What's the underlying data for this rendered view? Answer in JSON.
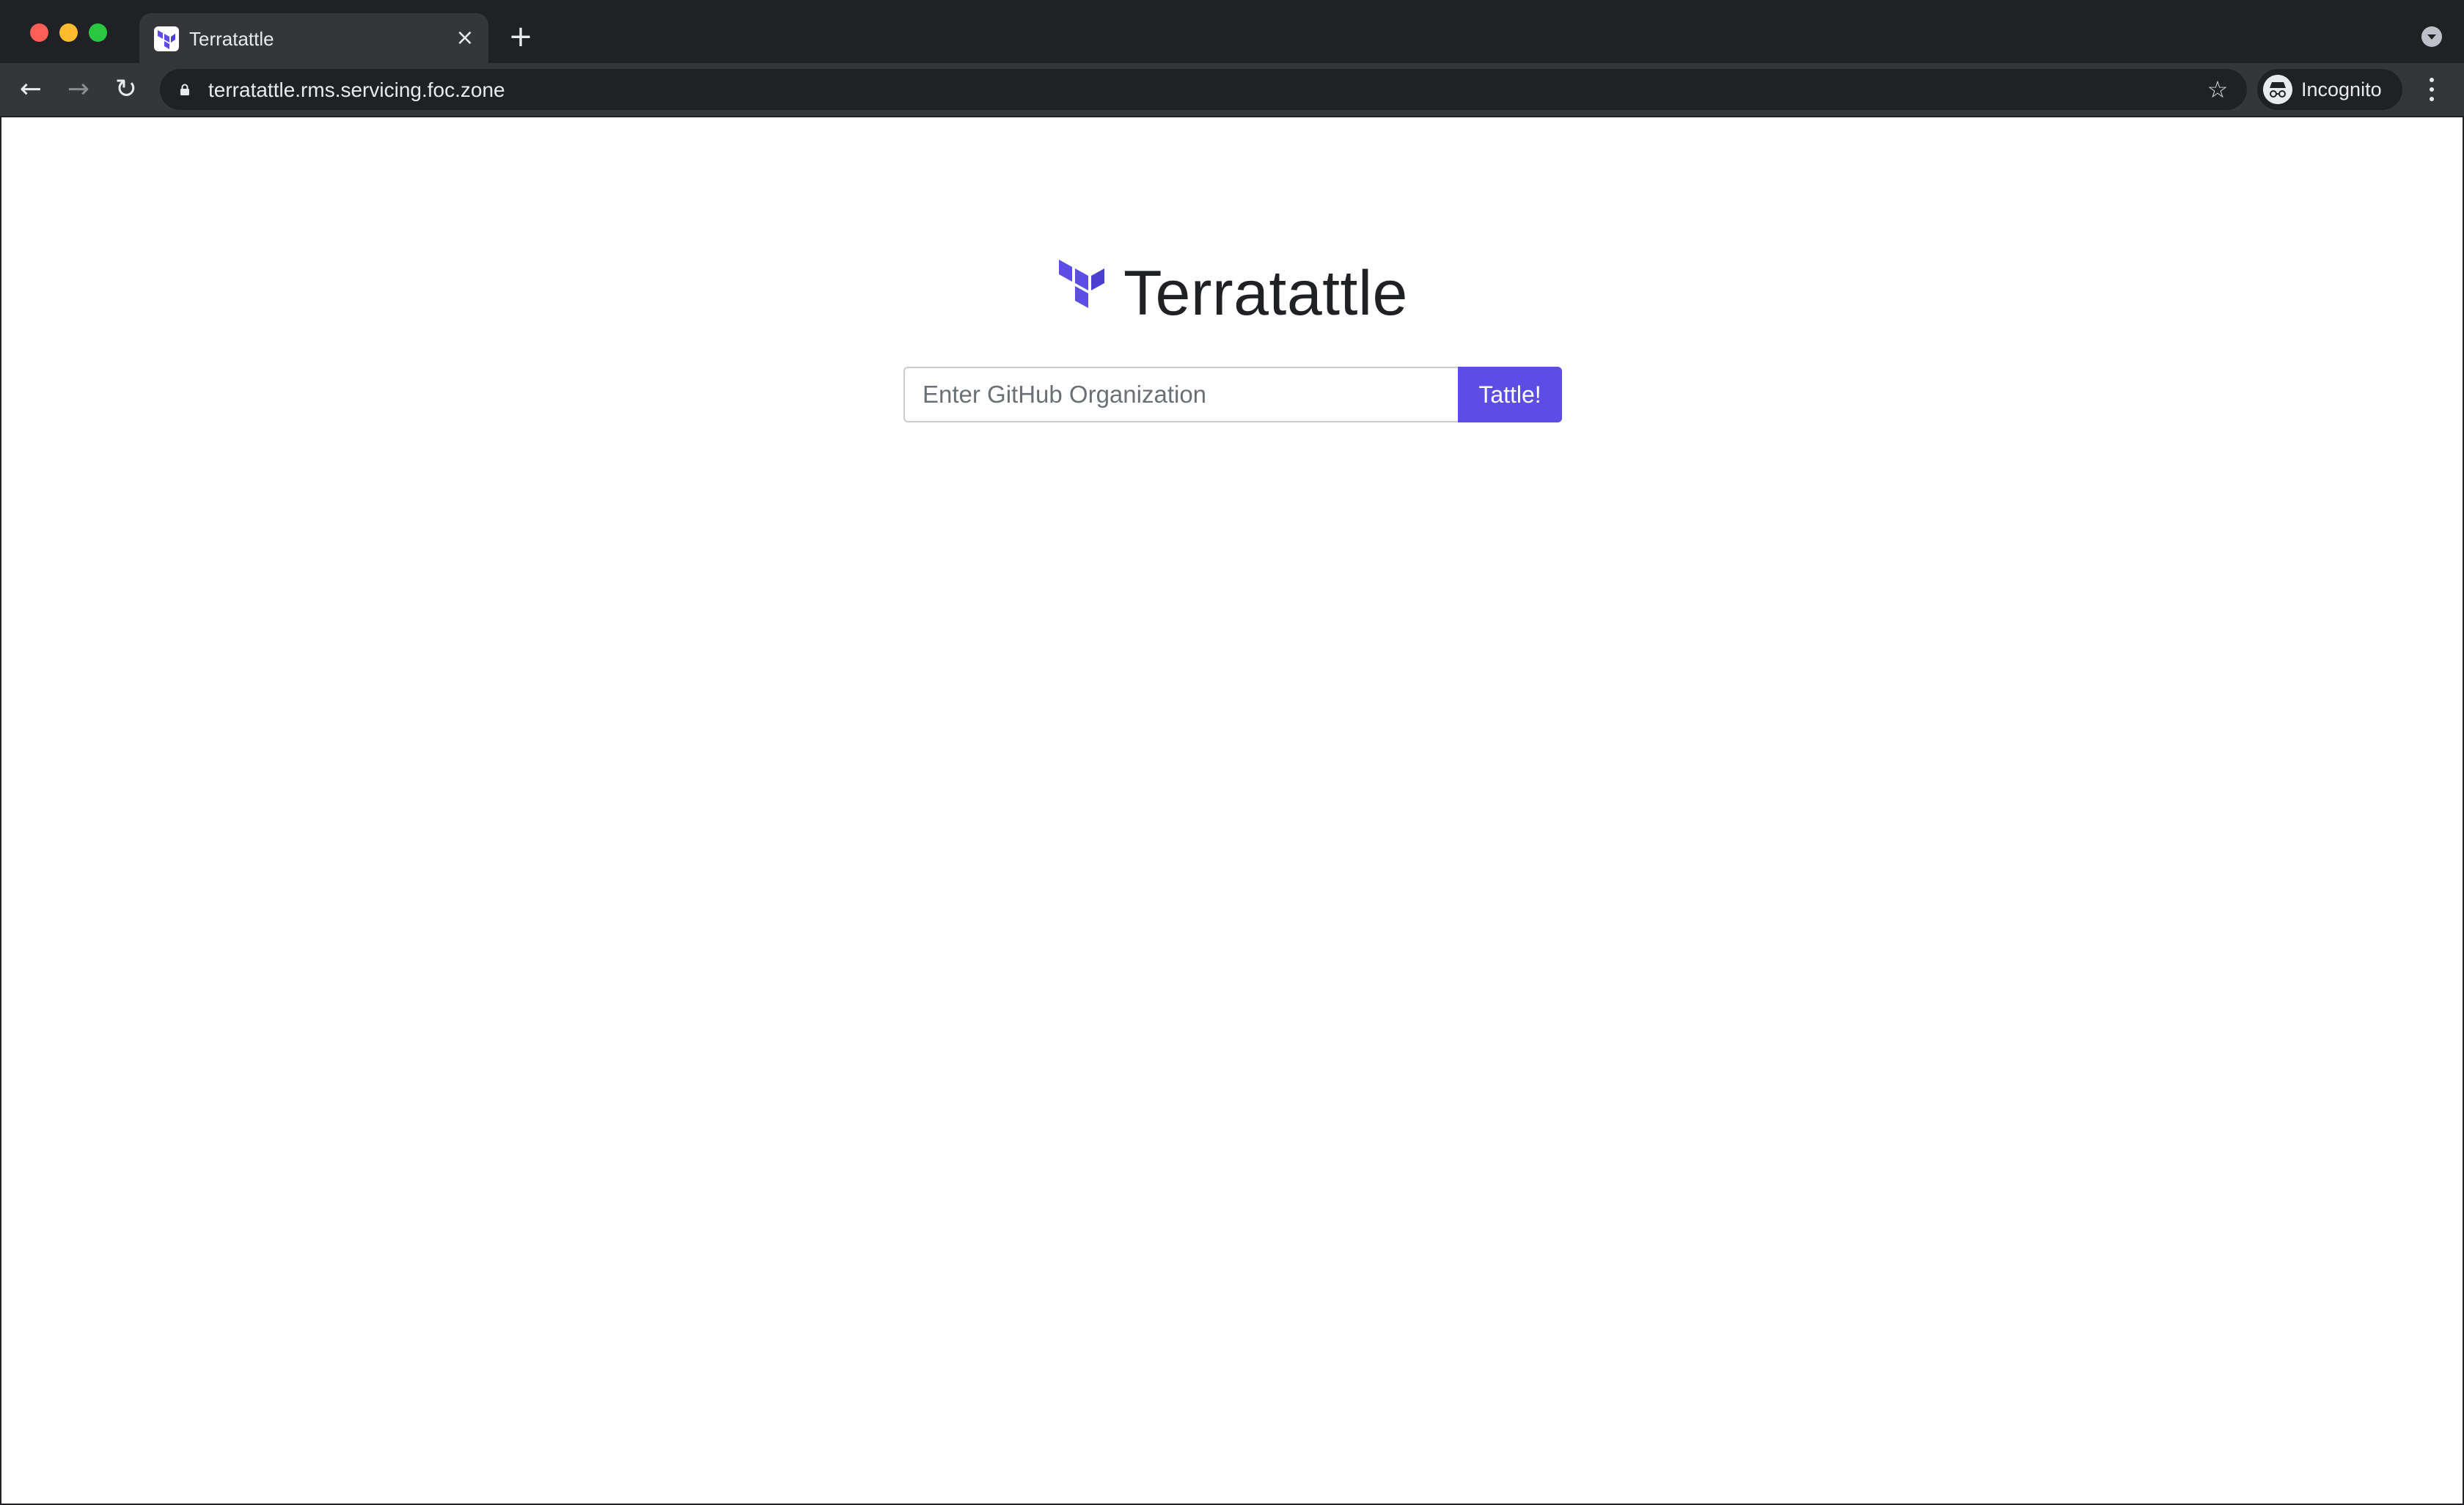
{
  "browser": {
    "tab": {
      "title": "Terratattle",
      "close_glyph": "×",
      "favicon": "terraform-logo-icon"
    },
    "new_tab_glyph": "+",
    "nav": {
      "back_glyph": "←",
      "forward_glyph": "→",
      "reload_glyph": "↻"
    },
    "omnibox": {
      "url": "terratattle.rms.servicing.foc.zone",
      "bookmark_glyph": "☆"
    },
    "profile": {
      "label": "Incognito"
    }
  },
  "page": {
    "brand_title": "Terratattle",
    "search": {
      "placeholder": "Enter GitHub Organization",
      "value": "",
      "button_label": "Tattle!"
    }
  },
  "colors": {
    "brand_purple": "#5c4ee5",
    "title_text": "#1f2124",
    "chrome_dark": "#202124",
    "chrome_toolbar": "#35363a"
  }
}
